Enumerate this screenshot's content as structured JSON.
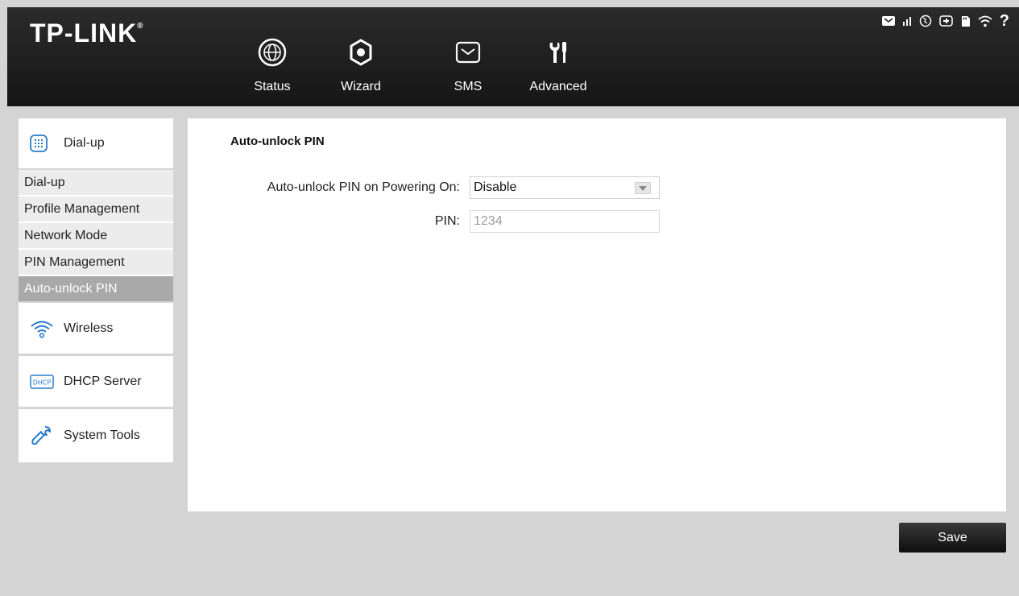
{
  "brand": {
    "logo_text": "TP-LINK",
    "logo_mark": "®"
  },
  "nav": [
    {
      "label": "Status",
      "icon": "globe-icon"
    },
    {
      "label": "Wizard",
      "icon": "wizard-gear-icon"
    },
    {
      "label": "SMS",
      "icon": "envelope-icon"
    },
    {
      "label": "Advanced",
      "icon": "tools-icon"
    }
  ],
  "nav_active": "Advanced",
  "status_icons": [
    "message-icon",
    "signal-icon",
    "internet-icon",
    "battery-icon",
    "sd-card-icon",
    "wifi-icon",
    "help-icon"
  ],
  "sidebar": {
    "dialup_head": "Dial-up",
    "dialup_items": [
      "Dial-up",
      "Profile Management",
      "Network Mode",
      "PIN Management",
      "Auto-unlock PIN"
    ],
    "active_item": "Auto-unlock PIN",
    "wireless": "Wireless",
    "dhcp": "DHCP Server",
    "dhcp_icon_text": "DHCP",
    "system_tools": "System Tools"
  },
  "content": {
    "title": "Auto-unlock PIN",
    "auto_unlock_label": "Auto-unlock PIN on Powering On:",
    "auto_unlock_value": "Disable",
    "pin_label": "PIN:",
    "pin_value": "1234"
  },
  "actions": {
    "save_label": "Save"
  },
  "colors": {
    "header_bg": "#1e1e1e",
    "active_sub_bg": "#a9a9a9",
    "page_bg": "#d4d4d4",
    "advanced_icon": "#ffffff"
  }
}
